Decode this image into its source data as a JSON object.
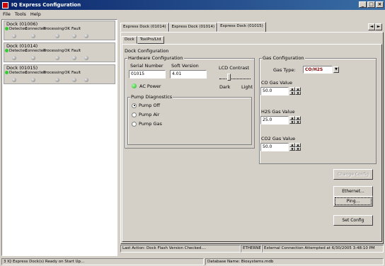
{
  "window": {
    "title": "IQ Express Configuration",
    "controls": [
      "_",
      "□",
      "×"
    ]
  },
  "menu": [
    "File",
    "Tools",
    "Help"
  ],
  "docks": [
    {
      "name": "Dock (01006)",
      "columns": [
        "Detected",
        "Connected",
        "Processing",
        "OK",
        "Fault"
      ]
    },
    {
      "name": "Dock (01014)",
      "columns": [
        "Detected",
        "Connected",
        "Processing",
        "OK",
        "Fault"
      ]
    },
    {
      "name": "Dock (01015)",
      "columns": [
        "Detected",
        "Connected",
        "Processing",
        "OK",
        "Fault"
      ]
    }
  ],
  "tabs": [
    "Express Dock (01014)",
    "Express Dock (01014)",
    "Express Dock (01015)"
  ],
  "tab_scroll": {
    "left": "◄",
    "right": "►"
  },
  "subtabs": [
    "Dock",
    "ToxiPro/Ltd"
  ],
  "dock_config": {
    "title": "Dock Configuration",
    "hardware": {
      "title": "Hardware Configuration",
      "serial_label": "Serial Number",
      "serial_value": "01015",
      "soft_label": "Soft Version",
      "soft_value": "4.01",
      "lcd_label": "LCD Contrast",
      "lcd_dark": "Dark",
      "lcd_light": "Light",
      "ac_power": "AC Power"
    },
    "pump": {
      "title": "Pump Diagnostics",
      "options": [
        "Pump Off",
        "Pump Air",
        "Pump Gas"
      ],
      "selected": "Pump Off"
    }
  },
  "gas_config": {
    "title": "Gas Configuration",
    "type_label": "Gas Type:",
    "type_value": "CO/H2S",
    "co_label": "CO Gas Value",
    "co_value": "50.0",
    "h2s_label": "H2S Gas Value",
    "h2s_value": "25.0",
    "co2_label": "CO2 Gas Value",
    "co2_value": "50.0"
  },
  "buttons": {
    "change_config": "Change Config",
    "ethernet": "Ethernet...",
    "ping": "Ping...",
    "set_config": "Set Config"
  },
  "last_action": {
    "text": "Last Action: Dock Flash Version Checked....",
    "connection": "ETHERNET",
    "message": "External Connection Attempted at 6/30/2005 3:48:10 PM"
  },
  "status": {
    "left": "3 IQ Express Dock(s) Ready on Start Up...",
    "right": "Database Name: Biosystems.mdb"
  }
}
